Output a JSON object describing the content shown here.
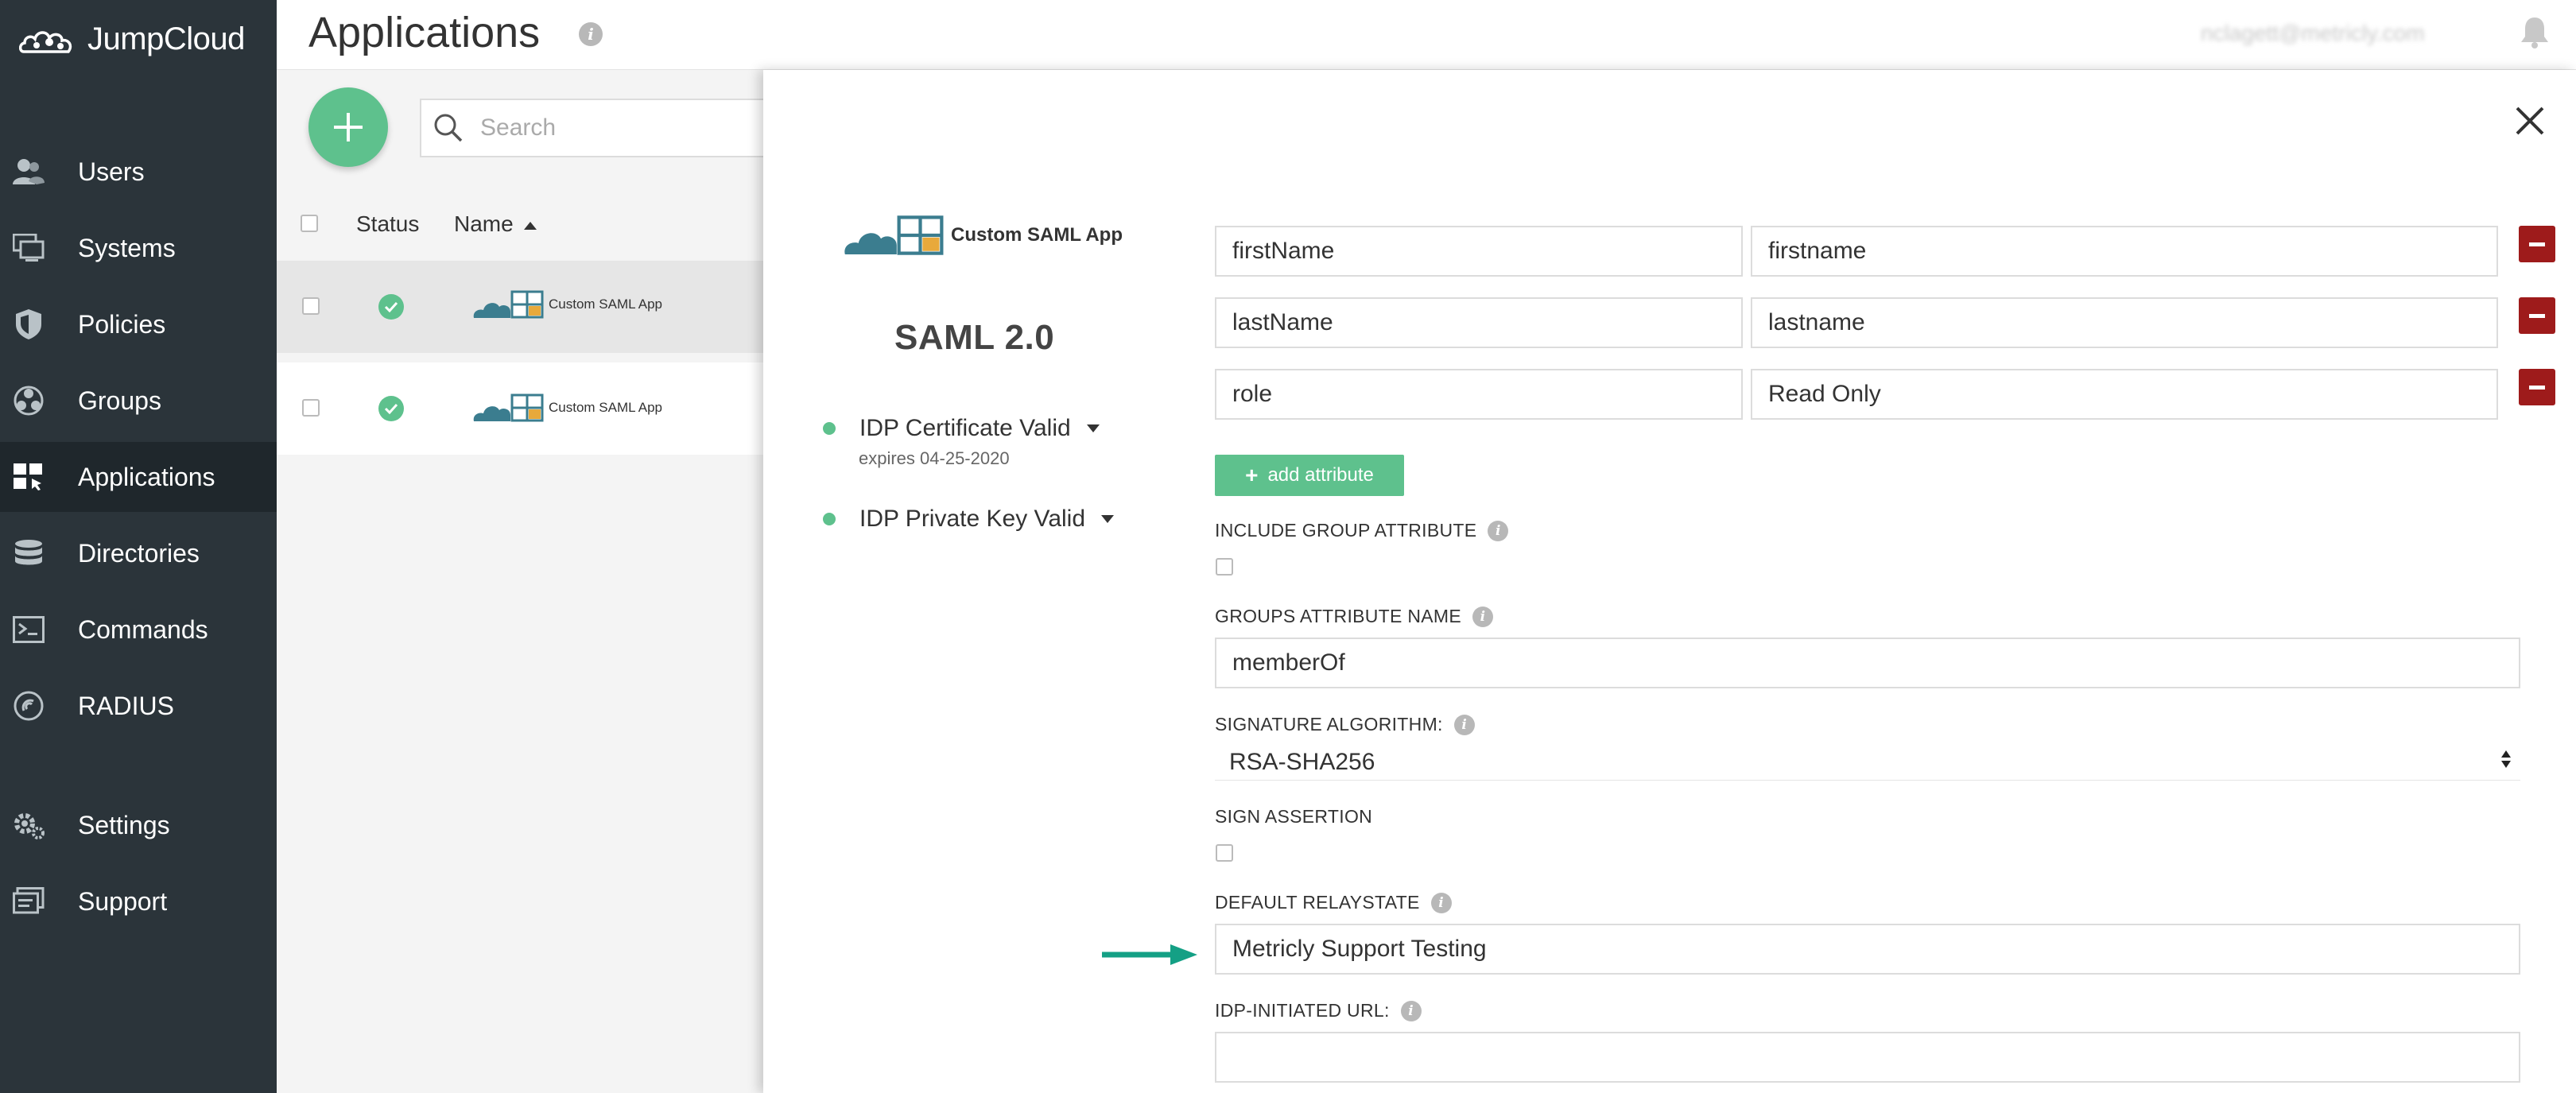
{
  "brand": {
    "name": "JumpCloud"
  },
  "sidebar": {
    "items": [
      {
        "label": "Users",
        "icon": "users-icon"
      },
      {
        "label": "Systems",
        "icon": "systems-icon"
      },
      {
        "label": "Policies",
        "icon": "policies-icon"
      },
      {
        "label": "Groups",
        "icon": "groups-icon"
      },
      {
        "label": "Applications",
        "icon": "applications-icon",
        "active": true
      },
      {
        "label": "Directories",
        "icon": "directories-icon"
      },
      {
        "label": "Commands",
        "icon": "commands-icon"
      },
      {
        "label": "RADIUS",
        "icon": "radius-icon"
      },
      {
        "label": "Settings",
        "icon": "settings-icon"
      },
      {
        "label": "Support",
        "icon": "support-icon"
      }
    ]
  },
  "header": {
    "title": "Applications",
    "user_email": "nclagett@metricly.com"
  },
  "list": {
    "search_placeholder": "Search",
    "columns": {
      "status": "Status",
      "name": "Name"
    },
    "rows": [
      {
        "app_label": "Custom SAML App",
        "status": "active"
      },
      {
        "app_label": "Custom SAML App",
        "status": "active"
      }
    ]
  },
  "panel": {
    "app_label": "Custom SAML App",
    "protocol": "SAML 2.0",
    "cert_status": "IDP Certificate Valid",
    "cert_expiry": "expires 04-25-2020",
    "key_status": "IDP Private Key Valid",
    "attributes": [
      {
        "service_name": "firstName",
        "jumpcloud_name": "firstname"
      },
      {
        "service_name": "lastName",
        "jumpcloud_name": "lastname"
      },
      {
        "service_name": "role",
        "jumpcloud_name": "Read Only"
      }
    ],
    "add_attribute_label": "add attribute",
    "include_group_attribute_label": "INCLUDE GROUP ATTRIBUTE",
    "groups_attribute_name_label": "GROUPS ATTRIBUTE NAME",
    "groups_attribute_name_value": "memberOf",
    "signature_algorithm_label": "SIGNATURE ALGORITHM:",
    "signature_algorithm_value": "RSA-SHA256",
    "sign_assertion_label": "SIGN ASSERTION",
    "default_relaystate_label": "DEFAULT RELAYSTATE",
    "default_relaystate_value": "Metricly Support Testing",
    "idp_initiated_url_label": "IDP-INITIATED URL:",
    "idp_initiated_url_value": ""
  },
  "colors": {
    "sidebar_bg": "#2b343a",
    "accent_green": "#5ec18d",
    "danger_red": "#9e1b1b",
    "cloud_teal": "#3b7d8f",
    "arrow_teal": "#14a085"
  }
}
